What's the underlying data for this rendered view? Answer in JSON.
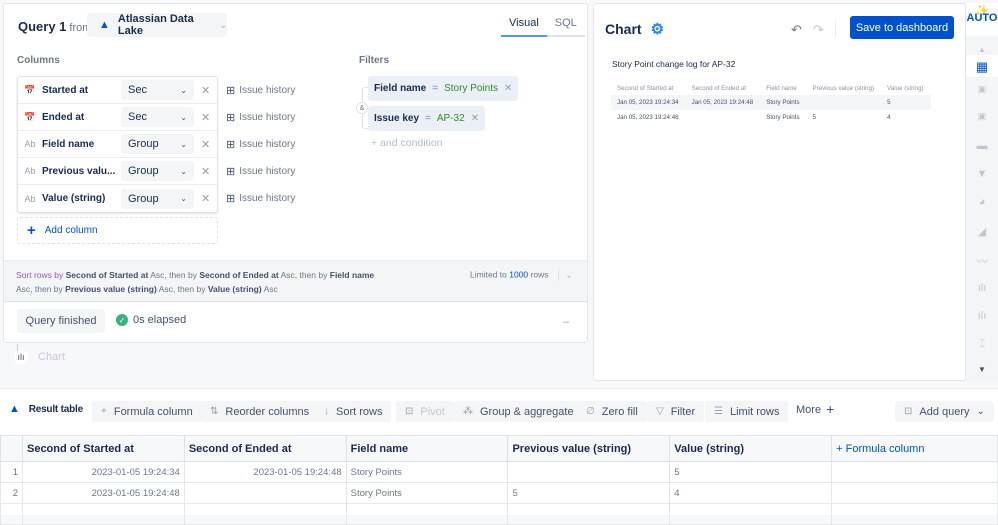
{
  "query": {
    "title": "Query 1",
    "from_label": "from",
    "source": "Atlassian Data Lake",
    "tabs": [
      {
        "label": "Visual",
        "active": true
      },
      {
        "label": "SQL",
        "active": false
      }
    ],
    "columns_label": "Columns",
    "columns": [
      {
        "icon": "calendar-icon",
        "name": "Started at",
        "agg": "Sec",
        "source": "Issue history"
      },
      {
        "icon": "text-type-icon",
        "name": "Ended at",
        "agg": "Sec",
        "source": "Issue history"
      },
      {
        "icon": "text-type-icon",
        "name": "Field name",
        "agg": "Group",
        "source": "Issue history"
      },
      {
        "icon": "text-type-icon",
        "name": "Previous valu...",
        "agg": "Group",
        "source": "Issue history"
      },
      {
        "icon": "text-type-icon",
        "name": "Value (string)",
        "agg": "Group",
        "source": "Issue history"
      }
    ],
    "add_column": "Add column",
    "filters_label": "Filters",
    "filters": [
      {
        "field": "Field name",
        "op": "=",
        "value": "Story Points"
      },
      {
        "field": "Issue key",
        "op": "=",
        "value": "AP-32"
      }
    ],
    "filter_join": "&",
    "and_condition": "+ and condition",
    "sort": {
      "p1": "Sort rows by",
      "c1": "Second of Started at",
      "d1": "Asc, then by",
      "c2": "Second of Ended at",
      "d2": "Asc, then by",
      "c3": "Field name",
      "d3": "Asc, then by",
      "c4": "Previous value (string)",
      "d4": "Asc, then by",
      "c5": "Value (string)",
      "d5": "Asc"
    },
    "limit_prefix": "Limited to",
    "limit_value": "1000",
    "limit_suffix": "rows",
    "status": "Query finished",
    "elapsed": "0s elapsed",
    "next_step": "Chart"
  },
  "chart": {
    "title": "Chart",
    "save_label": "Save to dashboard",
    "subtitle": "Story Point change log for AP-32",
    "headers": [
      "Second of Started at",
      "Second of Ended at",
      "Field name",
      "Previous value (string)",
      "Value (string)"
    ],
    "rows": [
      [
        "Jan 05, 2023 19:24:34",
        "Jan 05, 2023 19:24:48",
        "Story Points",
        "",
        "5"
      ],
      [
        "Jan 05, 2023 19:24:48",
        "",
        "Story Points",
        "5",
        "4"
      ]
    ],
    "rail_auto": "AUTO",
    "rail_icons": [
      "up-arrow-icon",
      "table-icon",
      "number-icon",
      "number-comparison-icon",
      "progress-bar-icon",
      "funnel-icon",
      "pie-chart-icon",
      "area-chart-icon",
      "line-chart-icon",
      "bar-chart-icon",
      "bar-line-chart-icon",
      "box-plot-icon",
      "down-arrow-icon"
    ]
  },
  "result": {
    "title": "Result table",
    "toolbar": [
      "Formula column",
      "Reorder columns",
      "Sort rows",
      "Pivot",
      "Group & aggregate",
      "Zero fill",
      "Filter",
      "Limit rows"
    ],
    "more": "More",
    "add_query": "Add query",
    "headers": [
      "Second of Started at",
      "Second of Ended at",
      "Field name",
      "Previous value (string)",
      "Value (string)"
    ],
    "formula_header": "+ Formula column",
    "rows": [
      [
        "1",
        "2023-01-05 19:24:34",
        "2023-01-05 19:24:48",
        "Story Points",
        "",
        "5"
      ],
      [
        "2",
        "2023-01-05 19:24:48",
        "",
        "Story Points",
        "5",
        "4"
      ]
    ]
  }
}
